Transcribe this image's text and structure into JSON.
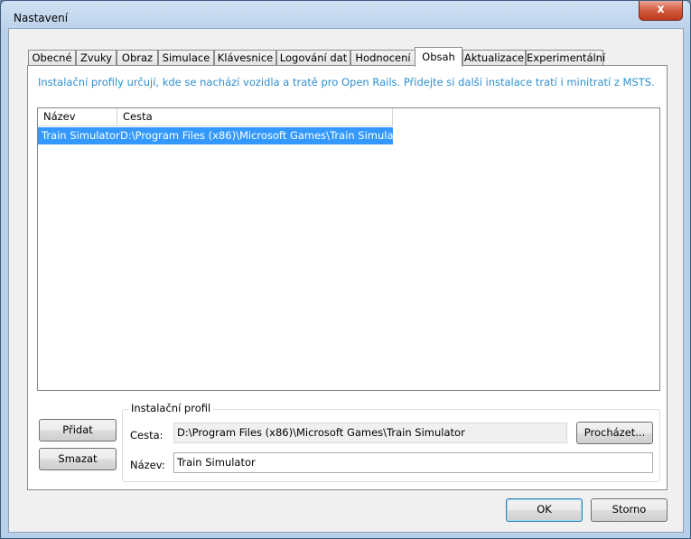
{
  "window": {
    "title": "Nastavení",
    "close_symbol": "x"
  },
  "tabs": [
    {
      "label": "Obecné",
      "active": false
    },
    {
      "label": "Zvuky",
      "active": false
    },
    {
      "label": "Obraz",
      "active": false
    },
    {
      "label": "Simulace",
      "active": false
    },
    {
      "label": "Klávesnice",
      "active": false
    },
    {
      "label": "Logování dat",
      "active": false
    },
    {
      "label": "Hodnocení",
      "active": false
    },
    {
      "label": "Obsah",
      "active": true
    },
    {
      "label": "Aktualizace",
      "active": false
    },
    {
      "label": "Experimentální",
      "active": false
    }
  ],
  "content": {
    "info_text": "Instalační profily určují, kde se nachází vozidla a tratě pro Open Rails. Přidejte si další instalace tratí i minitratí z MSTS.",
    "list": {
      "columns": [
        "Název",
        "Cesta"
      ],
      "rows": [
        {
          "name": "Train Simulator",
          "path": "D:\\Program Files (x86)\\Microsoft Games\\Train Simulator",
          "selected": true
        }
      ]
    },
    "buttons": {
      "add": "Přidat",
      "delete": "Smazat"
    },
    "profile": {
      "group_title": "Instalační profil",
      "path_label": "Cesta:",
      "path_value": "D:\\Program Files (x86)\\Microsoft Games\\Train Simulator",
      "browse_label": "Procházet...",
      "name_label": "Název:",
      "name_value": "Train Simulator"
    }
  },
  "dialog_buttons": {
    "ok": "OK",
    "cancel": "Storno"
  },
  "colors": {
    "info_text": "#2d8fd0",
    "selection": "#3399ff",
    "close_button": "#c03b1f"
  }
}
